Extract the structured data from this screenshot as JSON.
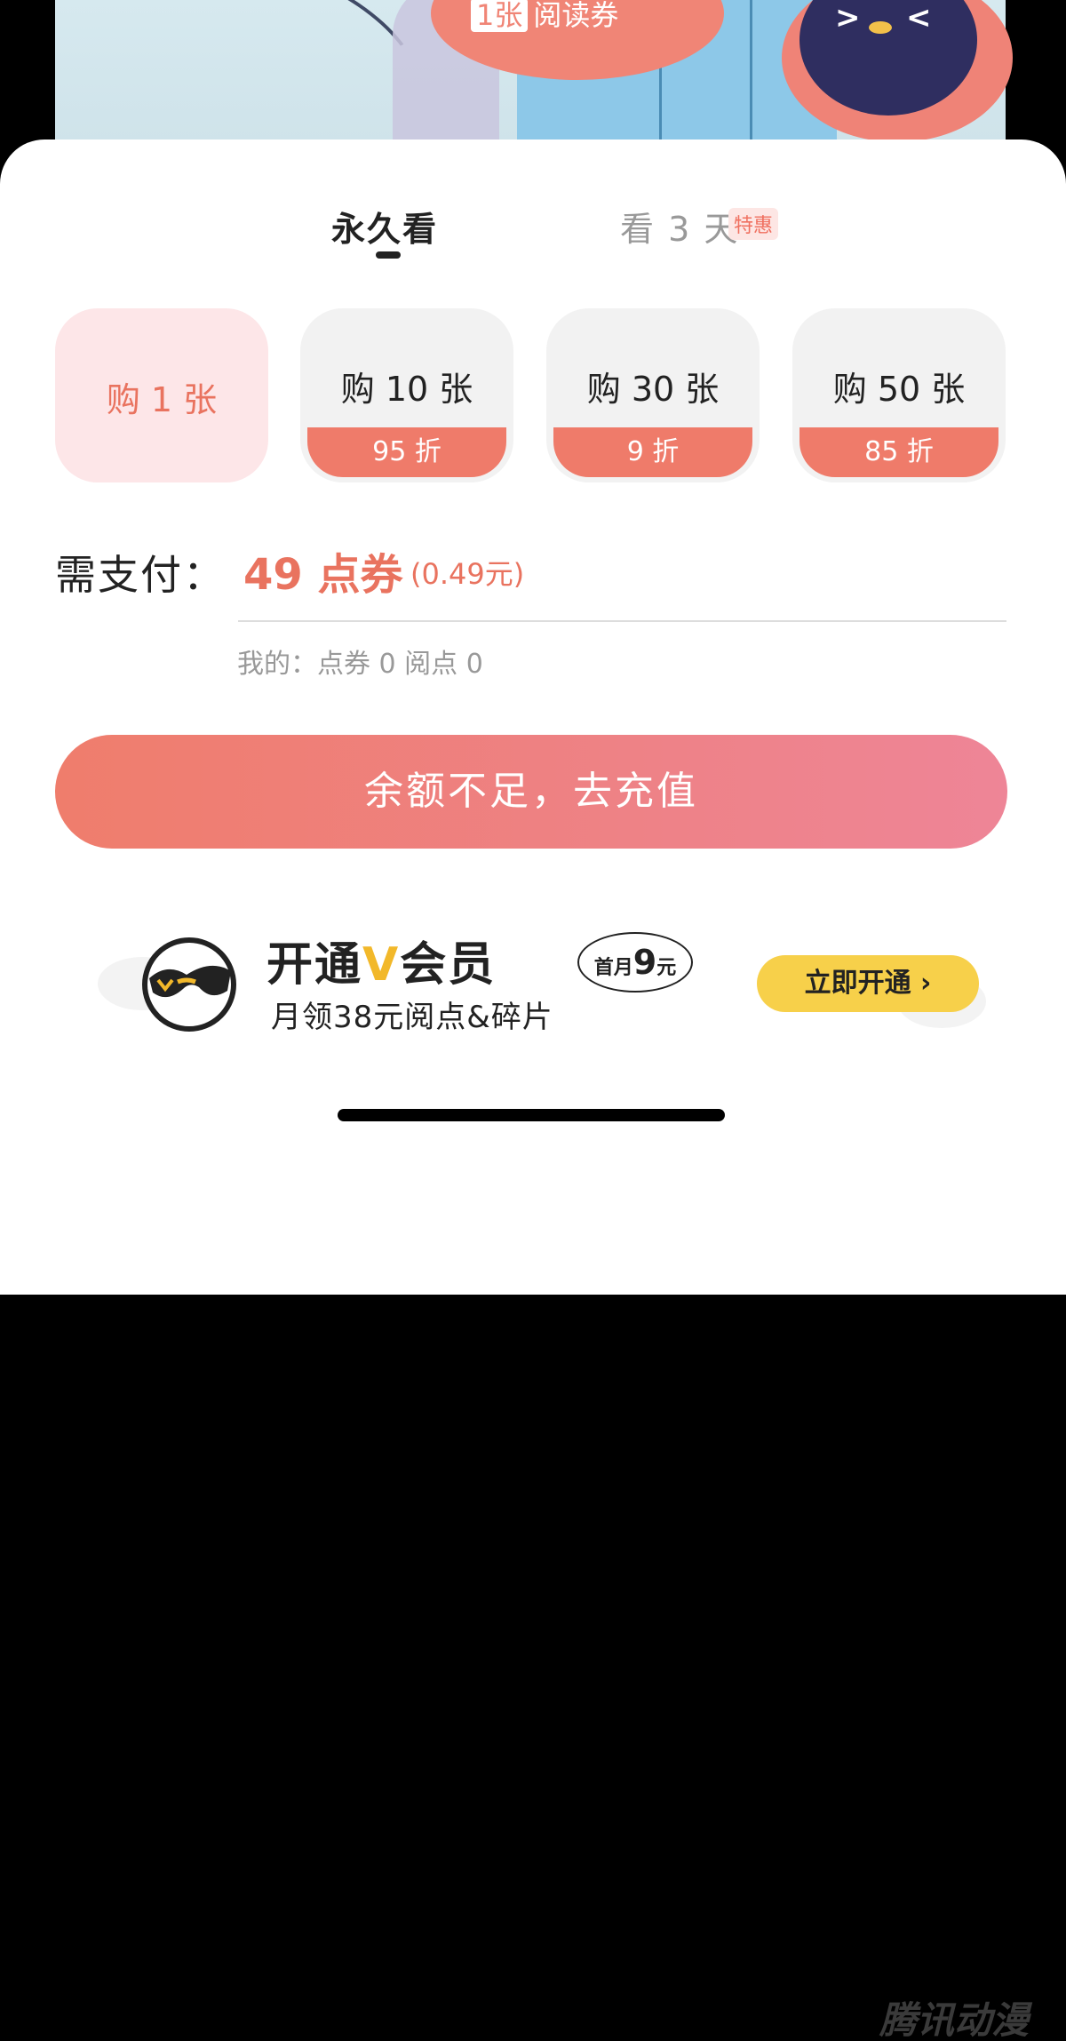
{
  "comic": {
    "bubble_tag": "1张",
    "bubble_text": "阅读券"
  },
  "tabs": {
    "permanent": "永久看",
    "three_days": "看 3 天",
    "special_badge": "特惠"
  },
  "options": [
    {
      "label": "购 1 张",
      "discount": "",
      "selected": true
    },
    {
      "label": "购 10 张",
      "discount": "95 折",
      "selected": false
    },
    {
      "label": "购 30 张",
      "discount": "9 折",
      "selected": false
    },
    {
      "label": "购 50 张",
      "discount": "85 折",
      "selected": false
    }
  ],
  "payment": {
    "label": "需支付：",
    "amount": "49 点券",
    "rmb": "(0.49元)",
    "balance": "我的：点券 0 阅点 0"
  },
  "recharge_button": "余额不足，去充值",
  "vip": {
    "title_a": "开通",
    "title_v": "V",
    "title_b": "会员",
    "price_small": "首月",
    "price_big": "9",
    "price_unit": "元",
    "subtitle": "月领38元阅点&碎片",
    "button": "立即开通 ›"
  },
  "watermark": "腾讯动漫",
  "colors": {
    "accent": "#e9735f",
    "discount_band": "#ef7b6a",
    "vip_yellow": "#f7d04a"
  }
}
